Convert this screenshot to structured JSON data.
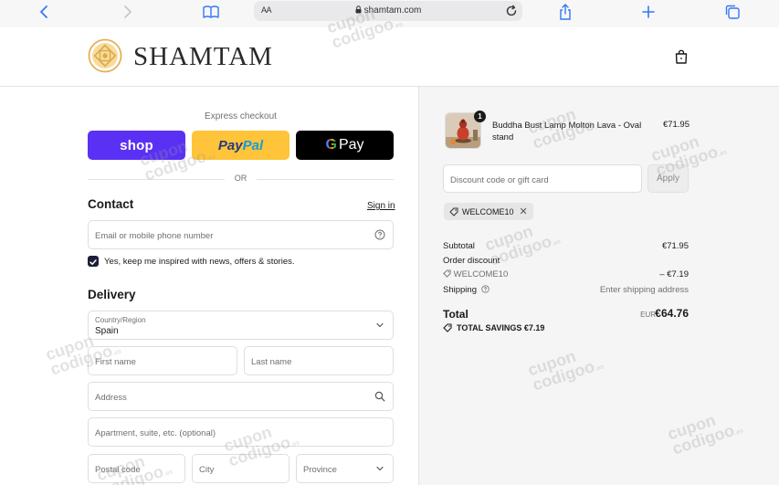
{
  "browser": {
    "text_size_label": "AA",
    "url": "shamtam.com"
  },
  "header": {
    "brand": "SHAMTAM"
  },
  "express": {
    "title": "Express checkout",
    "shop_label": "shop",
    "paypal_label_1": "Pay",
    "paypal_label_2": "Pal",
    "gpay_g": "G",
    "gpay_label": "Pay",
    "or_label": "OR"
  },
  "contact": {
    "heading": "Contact",
    "signin_label": "Sign in",
    "email_placeholder": "Email or mobile phone number",
    "newsletter_label": "Yes, keep me inspired with news, offers & stories.",
    "newsletter_checked": true
  },
  "delivery": {
    "heading": "Delivery",
    "country_label": "Country/Region",
    "country_value": "Spain",
    "first_name_placeholder": "First name",
    "last_name_placeholder": "Last name",
    "address_placeholder": "Address",
    "apartment_placeholder": "Apartment, suite, etc. (optional)",
    "postal_placeholder": "Postal code",
    "city_placeholder": "City",
    "province_placeholder": "Province"
  },
  "order": {
    "item_name": "Buddha Bust Lamp Molton Lava - Oval stand",
    "item_qty": "1",
    "item_price": "€71.95",
    "discount_placeholder": "Discount code or gift card",
    "apply_label": "Apply",
    "applied_code": "WELCOME10",
    "subtotal_label": "Subtotal",
    "subtotal_value": "€71.95",
    "order_discount_label": "Order discount",
    "discount_code": "WELCOME10",
    "discount_value": "– €7.19",
    "shipping_label": "Shipping",
    "shipping_value": "Enter shipping address",
    "total_label": "Total",
    "total_currency": "EUR",
    "total_value": "€64.76",
    "savings_label": "TOTAL SAVINGS",
    "savings_value": "€7.19"
  },
  "watermark": {
    "line1": "cupon",
    "line2": "codigoo",
    "suffix": ".es"
  },
  "colors": {
    "shop_purple": "#5a31f4",
    "paypal_yellow": "#ffc439",
    "gpay_black": "#000000",
    "checkbox_navy": "#1c1d3a",
    "safari_blue": "#3478f6"
  },
  "icons": [
    "back-icon",
    "forward-icon",
    "bookmarks-icon",
    "lock-icon",
    "reload-icon",
    "share-icon",
    "new-tab-icon",
    "tabs-icon",
    "shopping-bag-icon",
    "help-circle-icon",
    "chevron-down-icon",
    "search-icon",
    "tag-icon",
    "info-icon",
    "close-icon",
    "check-icon",
    "brand-logo-icon"
  ]
}
